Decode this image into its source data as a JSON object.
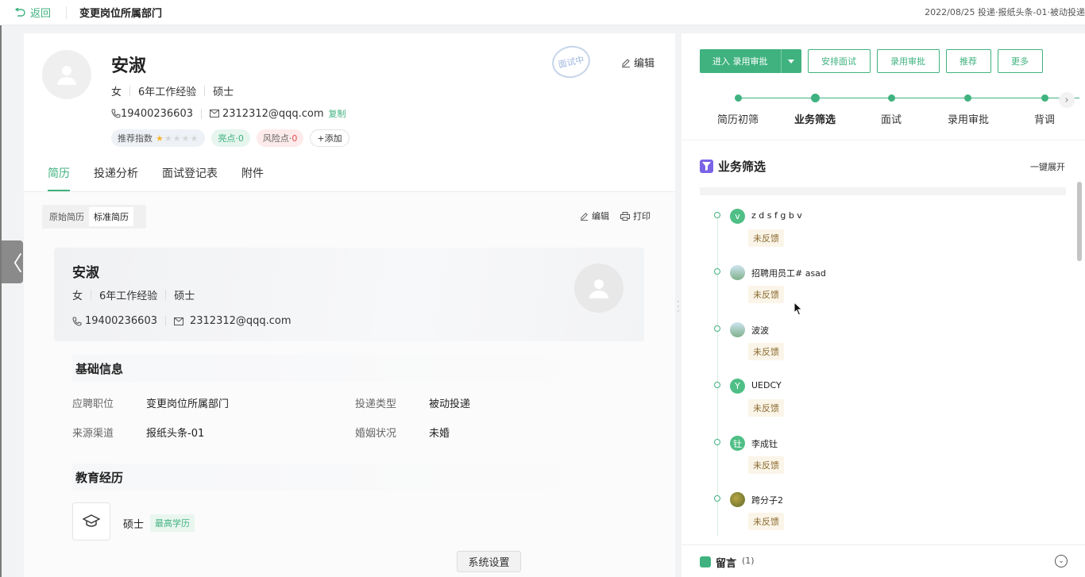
{
  "topbar": {
    "back_label": "返回",
    "title": "变更岗位所属部门",
    "right_text": "2022/08/25 投递·报纸头条-01·被动投递"
  },
  "profile": {
    "name": "安淑",
    "gender": "女",
    "experience": "6年工作经验",
    "degree": "硕士",
    "phone": "19400236603",
    "email": "2312312@qqq.com",
    "copy_label": "复制",
    "tags": {
      "recommend_label": "推荐指数",
      "recommend_stars": 1,
      "recommend_max": 5,
      "highlight_label": "亮点·",
      "highlight_count": "0",
      "risk_label": "风险点·",
      "risk_count": "0",
      "add_label": "+添加"
    },
    "stamp_text": "面试中",
    "edit_label": "编辑"
  },
  "tabs": [
    {
      "label": "简历"
    },
    {
      "label": "投递分析"
    },
    {
      "label": "面试登记表"
    },
    {
      "label": "附件"
    }
  ],
  "resume_toggle": {
    "original": "原始简历",
    "standard": "标准简历"
  },
  "resume_tools": {
    "edit": "编辑",
    "print": "打印"
  },
  "card": {
    "name": "安淑",
    "gender": "女",
    "experience": "6年工作经验",
    "degree": "硕士",
    "phone": "19400236603",
    "email": "2312312@qqq.com"
  },
  "basic_info": {
    "title": "基础信息",
    "fields": [
      {
        "k": "应聘职位",
        "v": "变更岗位所属部门"
      },
      {
        "k": "投递类型",
        "v": "被动投递"
      },
      {
        "k": "来源渠道",
        "v": "报纸头条-01"
      },
      {
        "k": "婚姻状况",
        "v": "未婚"
      }
    ]
  },
  "education": {
    "title": "教育经历",
    "degree": "硕士",
    "badge": "最高学历"
  },
  "system_settings": "系统设置",
  "actions": {
    "main": "进入 录用审批",
    "buttons": [
      "安排面试",
      "录用审批",
      "推荐",
      "更多"
    ]
  },
  "steps": [
    {
      "label": "简历初筛",
      "active": false
    },
    {
      "label": "业务筛选",
      "active": true
    },
    {
      "label": "面试",
      "active": false
    },
    {
      "label": "录用审批",
      "active": false
    },
    {
      "label": "背调",
      "active": false
    }
  ],
  "screening": {
    "title": "业务筛选",
    "expand_label": "一键展开",
    "items": [
      {
        "avatar": "v",
        "name": "z d s f g b v",
        "status": "未反馈"
      },
      {
        "avatar": "",
        "name": "招聘用员工# asad",
        "status": "未反馈"
      },
      {
        "avatar": "",
        "name": "波波",
        "status": "未反馈"
      },
      {
        "avatar": "Y",
        "name": "UEDCY",
        "status": "未反馈"
      },
      {
        "avatar": "钍",
        "name": "李成钍",
        "status": "未反馈"
      },
      {
        "avatar": "",
        "name": "跨分子2",
        "status": "未反馈"
      }
    ]
  },
  "message": {
    "title": "留言",
    "count": "(1)"
  },
  "colors": {
    "accent": "#3fb27f",
    "filter_icon": "#7b63e6",
    "danger": "#e24b4b"
  }
}
